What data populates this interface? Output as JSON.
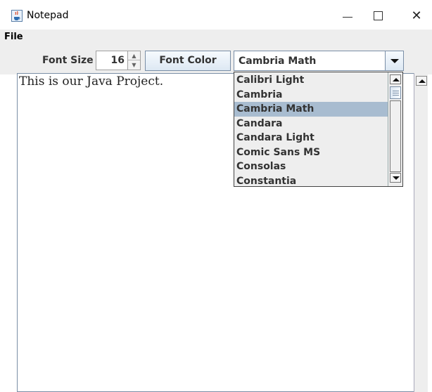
{
  "window": {
    "title": "Notepad",
    "minimize_glyph": "",
    "maximize_glyph": "",
    "close_glyph": "✕"
  },
  "menu": {
    "file_label": "File"
  },
  "toolbar": {
    "font_size_label": "Font Size",
    "font_size_value": "16",
    "font_color_label": "Font Color",
    "font_selected": "Cambria Math"
  },
  "font_list": {
    "items": [
      "Calibri Light",
      "Cambria",
      "Cambria Math",
      "Candara",
      "Candara Light",
      "Comic Sans MS",
      "Consolas",
      "Constantia"
    ],
    "selected_index": 2
  },
  "editor": {
    "text": "This is our Java Project."
  },
  "colors": {
    "selection": "#a8bcd0",
    "panel_bg": "#eeeeee",
    "border": "#7a8ea6"
  },
  "icons": {
    "app": "java-cup-icon",
    "spinner_up": "arrow-up-icon",
    "spinner_down": "arrow-down-icon",
    "combo": "chevron-down-icon"
  }
}
